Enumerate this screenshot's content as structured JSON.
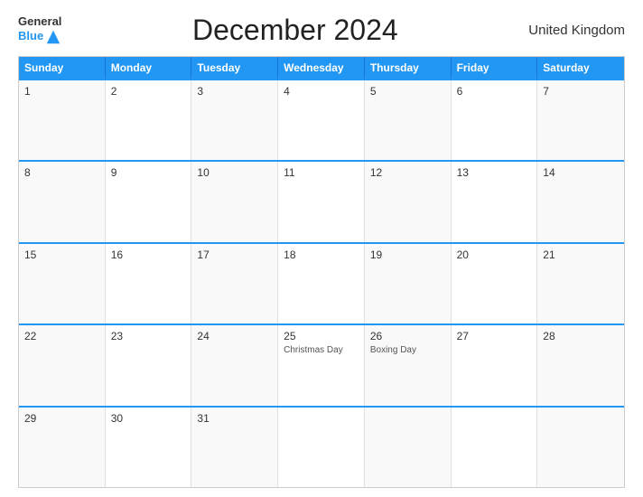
{
  "header": {
    "logo_general": "General",
    "logo_blue": "Blue",
    "title": "December 2024",
    "country": "United Kingdom"
  },
  "calendar": {
    "days_of_week": [
      "Sunday",
      "Monday",
      "Tuesday",
      "Wednesday",
      "Thursday",
      "Friday",
      "Saturday"
    ],
    "weeks": [
      [
        {
          "day": "1",
          "holiday": ""
        },
        {
          "day": "2",
          "holiday": ""
        },
        {
          "day": "3",
          "holiday": ""
        },
        {
          "day": "4",
          "holiday": ""
        },
        {
          "day": "5",
          "holiday": ""
        },
        {
          "day": "6",
          "holiday": ""
        },
        {
          "day": "7",
          "holiday": ""
        }
      ],
      [
        {
          "day": "8",
          "holiday": ""
        },
        {
          "day": "9",
          "holiday": ""
        },
        {
          "day": "10",
          "holiday": ""
        },
        {
          "day": "11",
          "holiday": ""
        },
        {
          "day": "12",
          "holiday": ""
        },
        {
          "day": "13",
          "holiday": ""
        },
        {
          "day": "14",
          "holiday": ""
        }
      ],
      [
        {
          "day": "15",
          "holiday": ""
        },
        {
          "day": "16",
          "holiday": ""
        },
        {
          "day": "17",
          "holiday": ""
        },
        {
          "day": "18",
          "holiday": ""
        },
        {
          "day": "19",
          "holiday": ""
        },
        {
          "day": "20",
          "holiday": ""
        },
        {
          "day": "21",
          "holiday": ""
        }
      ],
      [
        {
          "day": "22",
          "holiday": ""
        },
        {
          "day": "23",
          "holiday": ""
        },
        {
          "day": "24",
          "holiday": ""
        },
        {
          "day": "25",
          "holiday": "Christmas Day"
        },
        {
          "day": "26",
          "holiday": "Boxing Day"
        },
        {
          "day": "27",
          "holiday": ""
        },
        {
          "day": "28",
          "holiday": ""
        }
      ],
      [
        {
          "day": "29",
          "holiday": ""
        },
        {
          "day": "30",
          "holiday": ""
        },
        {
          "day": "31",
          "holiday": ""
        },
        {
          "day": "",
          "holiday": ""
        },
        {
          "day": "",
          "holiday": ""
        },
        {
          "day": "",
          "holiday": ""
        },
        {
          "day": "",
          "holiday": ""
        }
      ]
    ]
  }
}
